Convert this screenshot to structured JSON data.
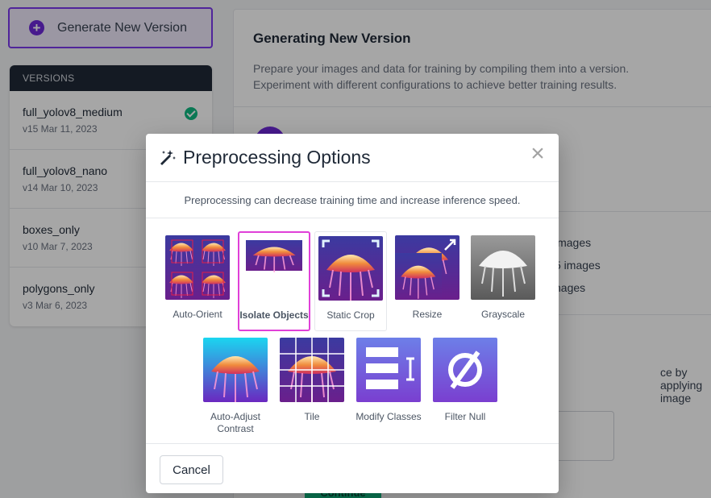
{
  "sidebar": {
    "generate_label": "Generate New Version",
    "versions_header": "VERSIONS",
    "versions": [
      {
        "name": "full_yolov8_medium",
        "sub": "v15 Mar 11, 2023",
        "checked": true
      },
      {
        "name": "full_yolov8_nano",
        "sub": "v14 Mar 10, 2023"
      },
      {
        "name": "boxes_only",
        "sub": "v10 Mar 7, 2023"
      },
      {
        "name": "polygons_only",
        "sub": "v3 Mar 6, 2023"
      }
    ]
  },
  "main": {
    "title": "Generating New Version",
    "desc_line1": "Prepare your images and data for training by compiling them into a version.",
    "desc_line2": "Experiment with different configurations to achieve better training results.",
    "stats": [
      "images",
      "5 images",
      "nages"
    ],
    "preprocess_text": "ce by applying image",
    "continue_label": "Continue"
  },
  "modal": {
    "title": "Preprocessing Options",
    "subtitle": "Preprocessing can decrease training time and increase inference speed.",
    "options": [
      {
        "label": "Auto-Orient",
        "icon": "auto-orient-icon"
      },
      {
        "label": "Isolate Objects",
        "icon": "isolate-objects-icon",
        "selected": true
      },
      {
        "label": "Static Crop",
        "icon": "static-crop-icon"
      },
      {
        "label": "Resize",
        "icon": "resize-icon"
      },
      {
        "label": "Grayscale",
        "icon": "grayscale-icon"
      },
      {
        "label": "Auto-Adjust Contrast",
        "icon": "auto-adjust-contrast-icon"
      },
      {
        "label": "Tile",
        "icon": "tile-icon"
      },
      {
        "label": "Modify Classes",
        "icon": "modify-classes-icon"
      },
      {
        "label": "Filter Null",
        "icon": "filter-null-icon"
      }
    ],
    "cancel_label": "Cancel"
  },
  "colors": {
    "accent": "#6d28d9",
    "selected_border": "#e040d8",
    "success": "#10b981"
  }
}
